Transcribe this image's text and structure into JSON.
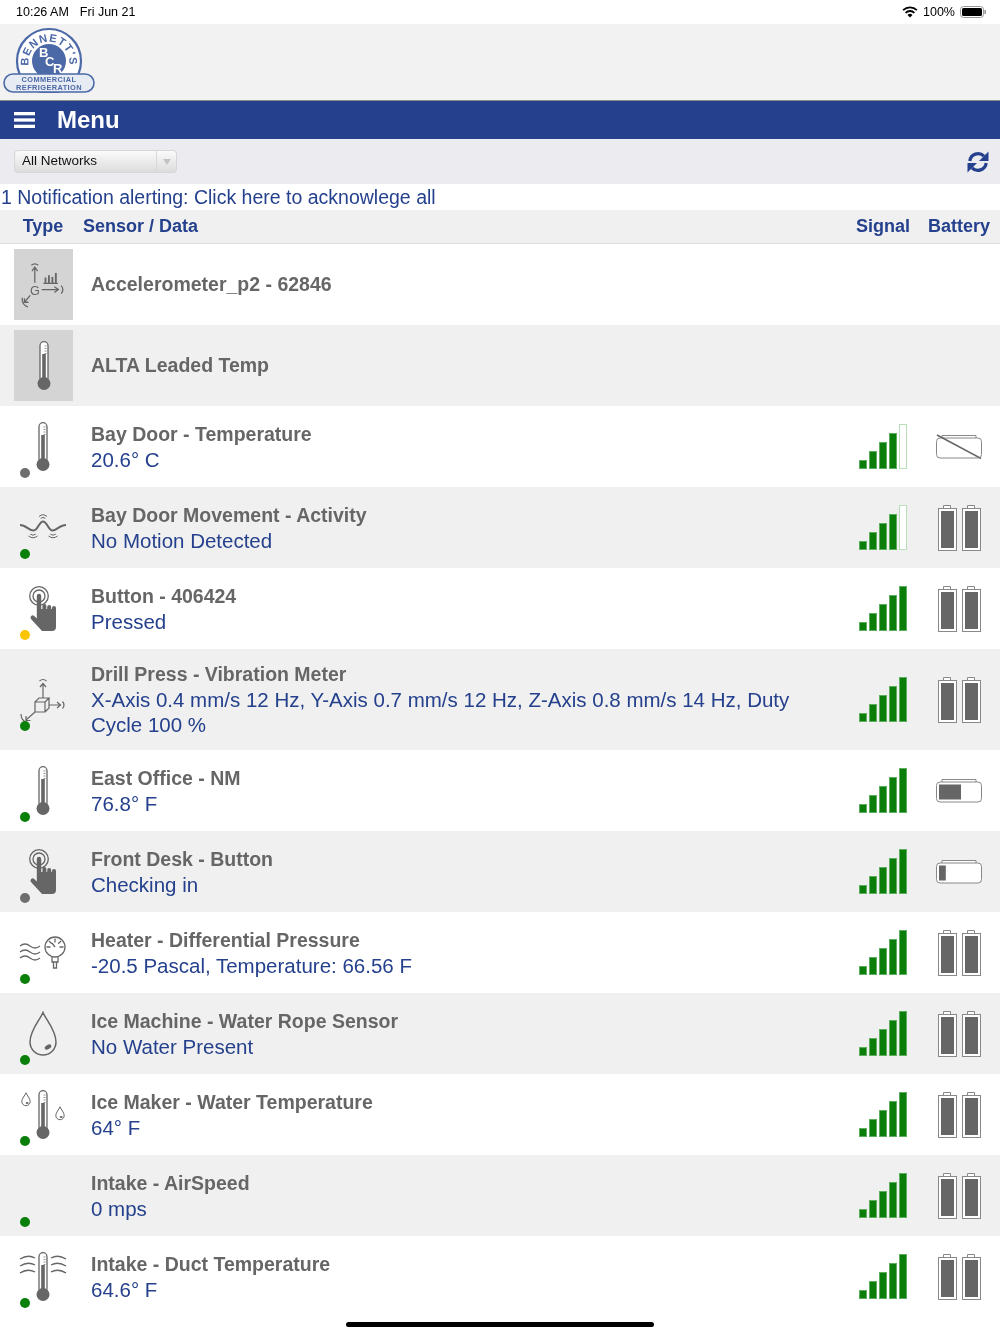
{
  "status_bar": {
    "time": "10:26 AM",
    "date": "Fri Jun 21",
    "battery": "100%"
  },
  "logo": {
    "arc_text": "BENNETT'S",
    "monogram": "BCR",
    "banner_lines": [
      "COMMERCIAL",
      "REFRIGERATION"
    ]
  },
  "nav": {
    "title": "Menu"
  },
  "toolbar": {
    "network_select": "All Networks"
  },
  "notification": "1 Notification alerting: Click here to acknowlege all",
  "table": {
    "columns": [
      "Type",
      "Sensor / Data",
      "Signal",
      "Battery"
    ],
    "rows": [
      {
        "kind": "accelerometer",
        "tile": true,
        "icon_label": "G",
        "name": "Accelerometer_p2 - 62846"
      },
      {
        "kind": "temperature",
        "tile": true,
        "name": "ALTA Leaded Temp"
      },
      {
        "kind": "temperature",
        "tile": false,
        "color": "#6e6e6e",
        "name": "Bay Door - Temperature",
        "reading": "20.6° C",
        "signal": {
          "kind": "partial"
        },
        "battery": {
          "kind": "crossed"
        }
      },
      {
        "kind": "activity",
        "tile": false,
        "color": "#0a7f0a",
        "name": "Bay Door Movement - Activity",
        "reading": "No Motion Detected",
        "signal": {
          "kind": "partial"
        },
        "battery": {
          "kind": "pair"
        }
      },
      {
        "kind": "button",
        "tile": false,
        "color": "#fbc400",
        "name": "Button - 406424",
        "reading": "Pressed",
        "signal": {
          "kind": "full"
        },
        "battery": {
          "kind": "pair"
        }
      },
      {
        "kind": "vibration",
        "tile": false,
        "color": "#0a7f0a",
        "name": "Drill Press - Vibration Meter",
        "reading": "X-Axis 0.4 mm/s 12 Hz, Y-Axis 0.7 mm/s 12 Hz, Z-Axis 0.8 mm/s 14 Hz, Duty Cycle 100 %",
        "signal": {
          "kind": "full"
        },
        "battery": {
          "kind": "pair"
        }
      },
      {
        "kind": "temperature",
        "tile": false,
        "color": "#0a7f0a",
        "name": "East Office - NM",
        "reading": "76.8° F",
        "signal": {
          "kind": "full"
        },
        "battery": {
          "kind": "half"
        }
      },
      {
        "kind": "button",
        "tile": false,
        "color": "#6e6e6e",
        "name": "Front Desk - Button",
        "reading": "Checking in",
        "signal": {
          "kind": "full"
        },
        "battery": {
          "kind": "low"
        }
      },
      {
        "kind": "pressure",
        "tile": false,
        "color": "#0a7f0a",
        "name": "Heater - Differential Pressure",
        "reading": "-20.5 Pascal, Temperature: 66.56 F",
        "signal": {
          "kind": "full"
        },
        "battery": {
          "kind": "pair"
        }
      },
      {
        "kind": "water-rope",
        "tile": false,
        "color": "#0a7f0a",
        "name": "Ice Machine - Water Rope Sensor",
        "reading": "No Water Present",
        "signal": {
          "kind": "full"
        },
        "battery": {
          "kind": "pair"
        }
      },
      {
        "kind": "water-temperature",
        "tile": false,
        "color": "#0a7f0a",
        "name": "Ice Maker - Water Temperature",
        "reading": "64° F",
        "signal": {
          "kind": "full"
        },
        "battery": {
          "kind": "pair"
        }
      },
      {
        "kind": "airspeed",
        "tile": false,
        "color": "#0a7f0a",
        "name": "Intake - AirSpeed",
        "reading": "0 mps",
        "signal": {
          "kind": "full"
        },
        "battery": {
          "kind": "pair"
        }
      },
      {
        "kind": "duct-temperature",
        "tile": false,
        "color": "#0a7f0a",
        "name": "Intake - Duct Temperature",
        "reading": "64.6° F",
        "signal": {
          "kind": "full"
        },
        "battery": {
          "kind": "pair"
        }
      }
    ]
  }
}
